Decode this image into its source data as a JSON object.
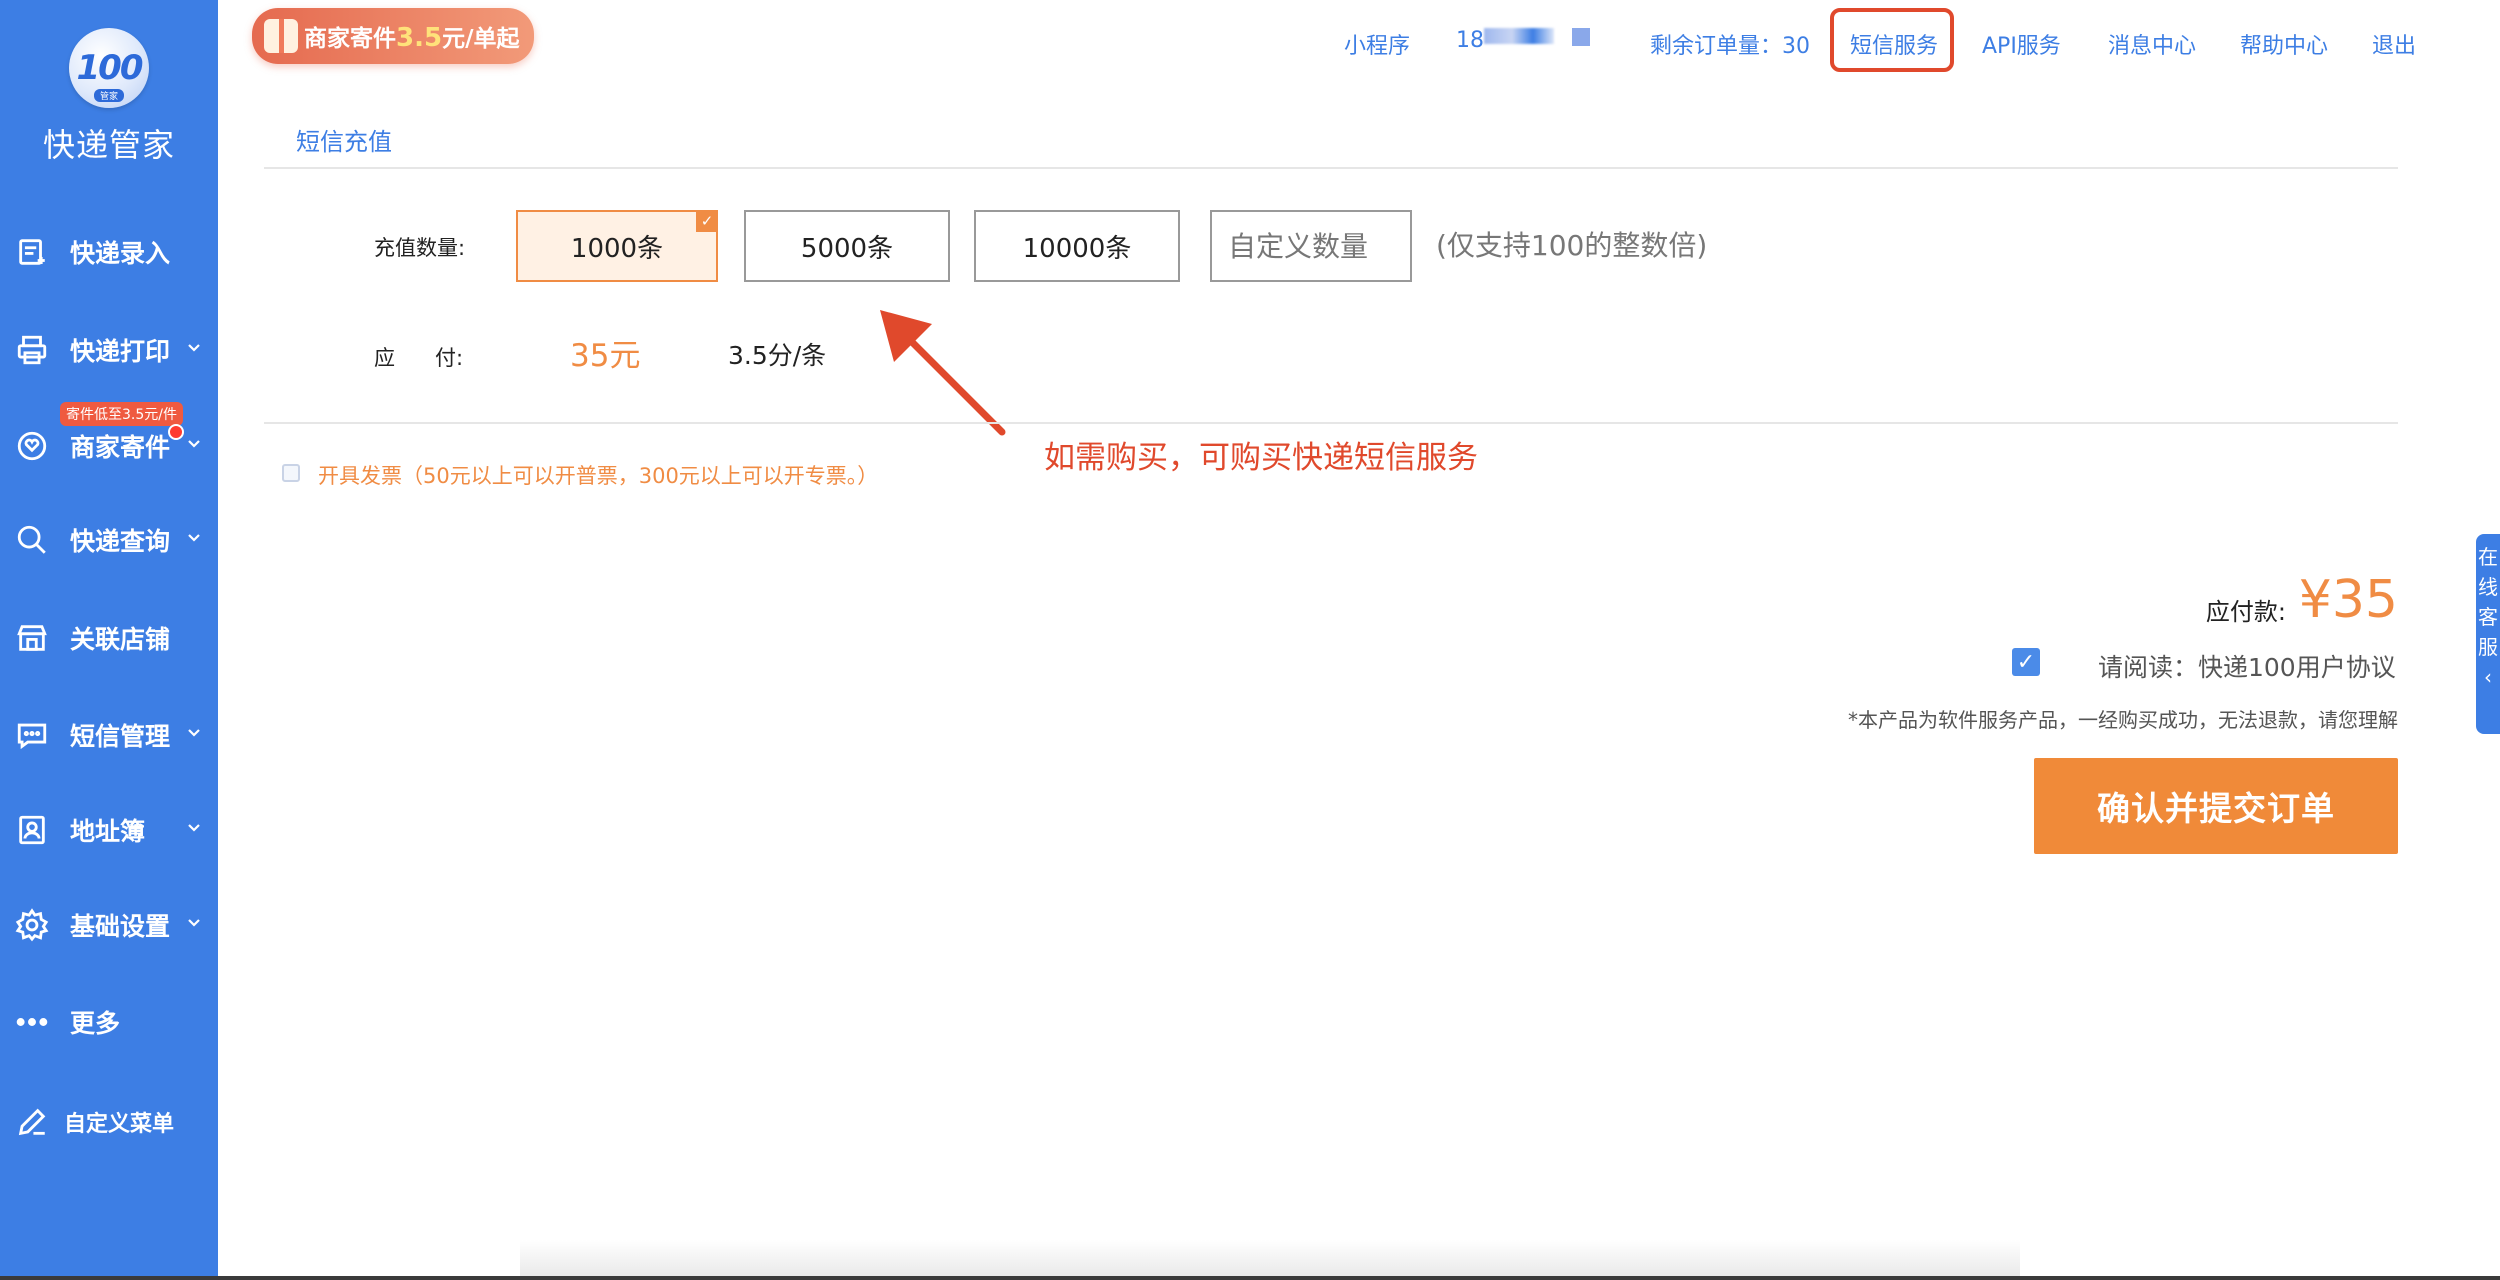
{
  "sidebar": {
    "logo_text": "100",
    "logo_sub": "管家",
    "title": "快递管家",
    "items": [
      {
        "label": "快递录入",
        "icon": "document-edit-icon",
        "has_arrow": false
      },
      {
        "label": "快递打印",
        "icon": "printer-icon",
        "has_arrow": true
      },
      {
        "label": "商家寄件",
        "icon": "shield-heart-icon",
        "has_arrow": true,
        "badge": "寄件低至3.5元/件"
      },
      {
        "label": "快递查询",
        "icon": "search-icon",
        "has_arrow": true
      },
      {
        "label": "关联店铺",
        "icon": "store-icon",
        "has_arrow": false
      },
      {
        "label": "短信管理",
        "icon": "message-icon",
        "has_arrow": true
      },
      {
        "label": "地址簿",
        "icon": "contacts-icon",
        "has_arrow": true
      },
      {
        "label": "基础设置",
        "icon": "gear-icon",
        "has_arrow": true
      },
      {
        "label": "更多",
        "icon": "more-dots-icon",
        "has_arrow": false
      },
      {
        "label": "自定义菜单",
        "icon": "pencil-icon",
        "has_arrow": false
      }
    ]
  },
  "banner": {
    "text_before": "商家寄件",
    "price": "3.5",
    "text_after": "元/单起"
  },
  "topnav": {
    "mini_program": "小程序",
    "phone_prefix": "18",
    "remaining_orders": "剩余订单量：30",
    "sms_service": "短信服务",
    "api_service": "API服务",
    "message_center": "消息中心",
    "help_center": "帮助中心",
    "logout": "退出"
  },
  "page": {
    "tab": "短信充值",
    "qty_label": "充值数量:",
    "qty_options": [
      "1000条",
      "5000条",
      "10000条"
    ],
    "selected_index": 0,
    "custom_placeholder": "自定义数量",
    "hint": "(仅支持100的整数倍)",
    "pay_label": "应      付:",
    "pay_value": "35元",
    "unit_price": "3.5分/条",
    "annotation": "如需购买，可购买快递短信服务",
    "invoice_label": "开具发票（50元以上可以开普票，300元以上可以开专票。）",
    "total_label": "应付款:",
    "total_amount": "¥35",
    "agree_text": "请阅读：快递100用户协议",
    "note": "*本产品为软件服务产品，一经购买成功，无法退款，请您理解",
    "submit": "确认并提交订单",
    "side_service": [
      "在",
      "线",
      "客",
      "服"
    ]
  },
  "colors": {
    "sidebar_bg": "#3d7ee4",
    "accent_orange": "#f08c44",
    "annotation_red": "#e0492c",
    "link_blue": "#3d7ee4"
  }
}
